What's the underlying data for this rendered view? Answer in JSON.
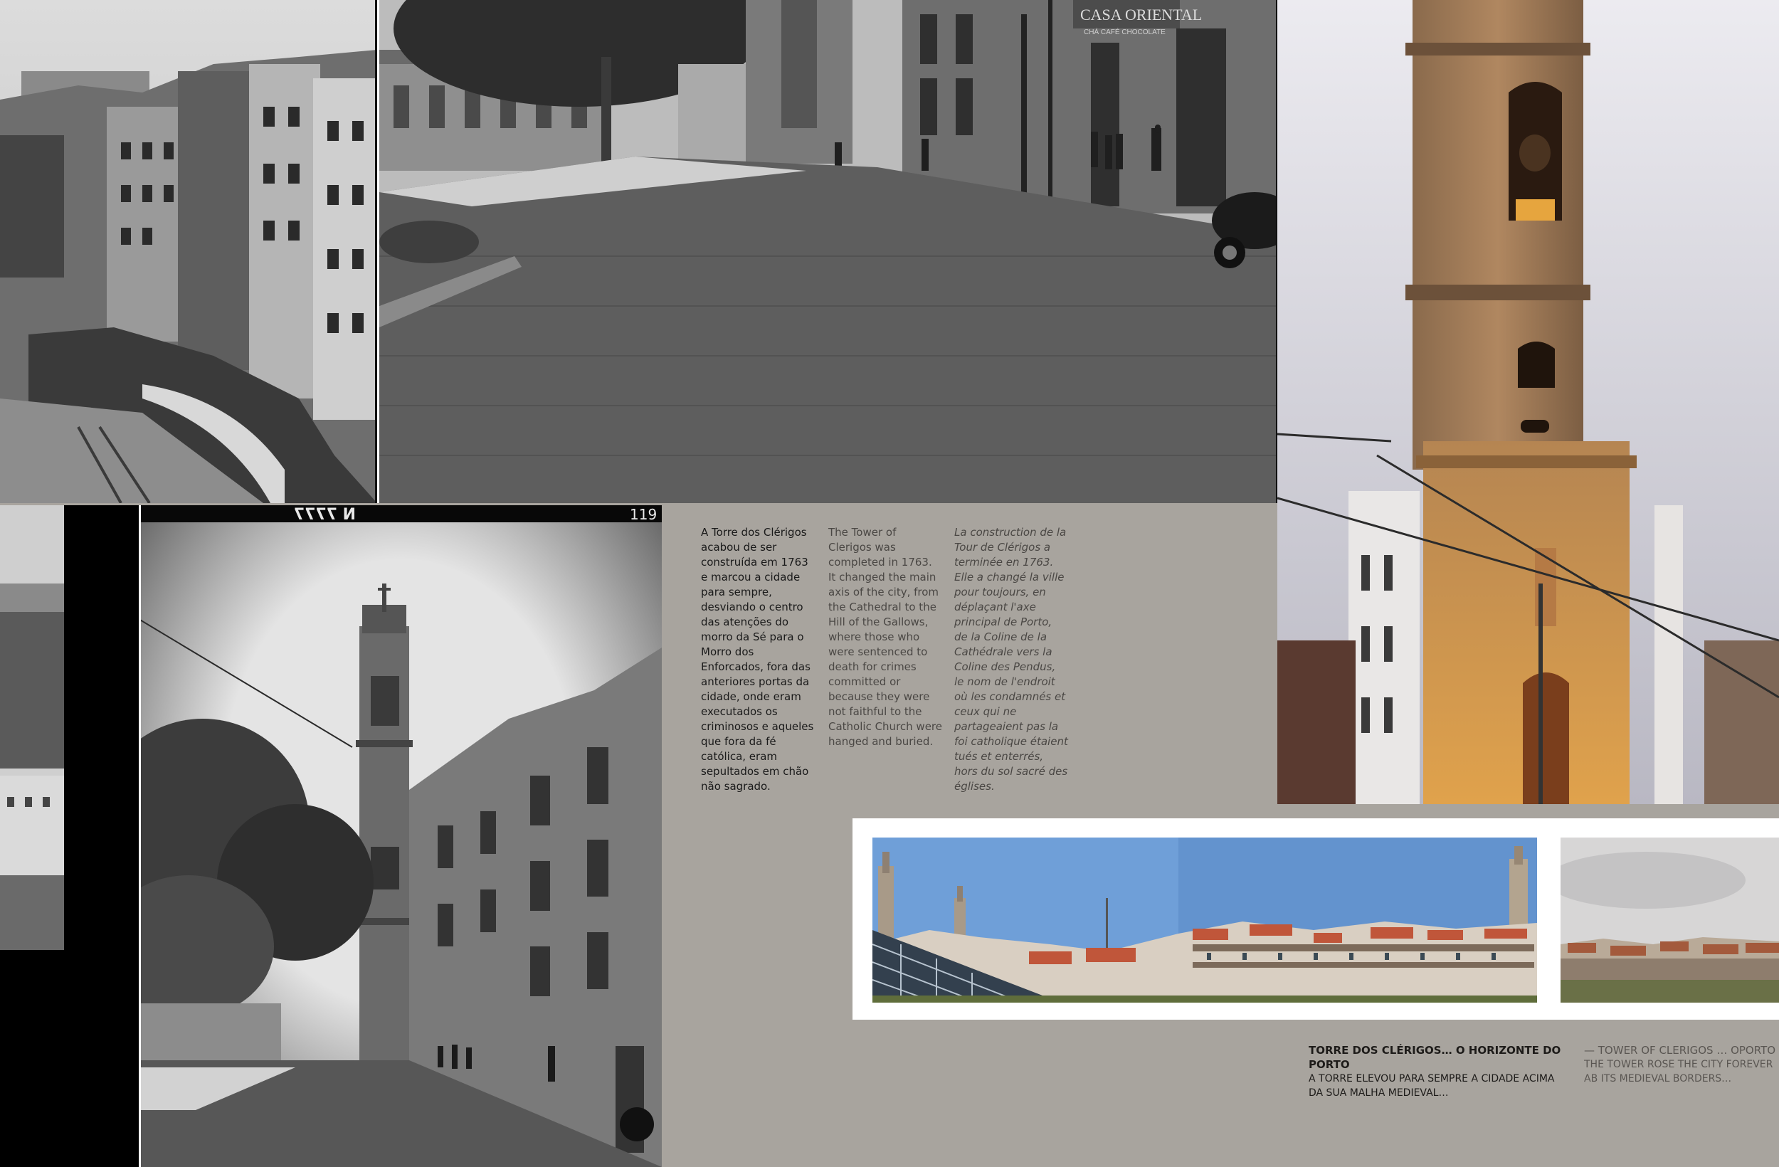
{
  "texts": {
    "pt": "A Torre dos Clérigos acabou de ser construída em 1763 e marcou a cidade para sempre, desviando o centro das atenções do morro da Sé para o Morro dos Enforcados, fora das anteriores portas da cidade, onde eram executados os criminosos e aqueles que fora da fé católica, eram sepultados em chão não sagrado.",
    "en": "The Tower of Clerigos was completed in 1763. It changed the main axis of the city, from the Cathedral to the Hill of the Gallows, where those who were sentenced to death for crimes committed or because they were not faithful to the Catholic Church were hanged and buried.",
    "fr": "La construction de la Tour de Clérigos a terminée en 1763. Elle a changé la ville pour toujours, en déplaçant l'axe principal de Porto, de la Coline de la Cathédrale vers la Coline des Pendus, le nom de l'endroit où les condamnés et ceux qui ne partageaient pas la foi catholique étaient tués et enterrés, hors du sol sacré des églises."
  },
  "captions": {
    "pt_title": "TORRE DOS CLÉRIGOS… O HORIZONTE DO PORTO",
    "pt_body": "A TORRE ELEVOU PARA SEMPRE A CIDADE ACIMA DA SUA MALHA MEDIEVAL…",
    "en_title": "— TOWER OF CLERIGOS … OPORTO SKY",
    "en_body": "THE TOWER ROSE THE CITY FOREVER AB ITS MEDIEVAL BORDERS…"
  },
  "signs": {
    "shop_sign": "CASA ORIENTAL",
    "shop_sub": "CHÁ CAFÉ CHOCOLATE",
    "negative_left": "N 7777",
    "negative_right": "119"
  },
  "colors": {
    "page_background": "#a8a49e",
    "photo_frame": "#ffffff",
    "sky_blue": "#6f9fd8",
    "tower_glow": "#d29a4e",
    "roof_terracotta": "#c0563a"
  }
}
